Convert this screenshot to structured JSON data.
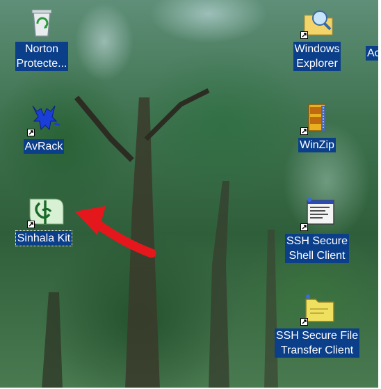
{
  "desktop": {
    "icons": [
      {
        "label_lines": [
          "Norton",
          "Protecte..."
        ],
        "icon": "recycle-bin-icon",
        "shortcut": false
      },
      {
        "label_lines": [
          "AvRack"
        ],
        "icon": "avrack-icon",
        "shortcut": true
      },
      {
        "label_lines": [
          "Sinhala Kit"
        ],
        "icon": "sinhala-kit-icon",
        "shortcut": true,
        "selected": true
      },
      {
        "label_lines": [
          "Windows",
          "Explorer"
        ],
        "icon": "windows-explorer-icon",
        "shortcut": true
      },
      {
        "label_lines": [
          "WinZip"
        ],
        "icon": "winzip-icon",
        "shortcut": true
      },
      {
        "label_lines": [
          "SSH Secure",
          "Shell Client"
        ],
        "icon": "ssh-shell-icon",
        "shortcut": true
      },
      {
        "label_lines": [
          "SSH Secure File",
          "Transfer Client"
        ],
        "icon": "ssh-file-transfer-icon",
        "shortcut": true
      }
    ],
    "partial_icon_label": "Ac",
    "annotation_color": "#e4181c",
    "label_background": "#0b3f8a"
  }
}
